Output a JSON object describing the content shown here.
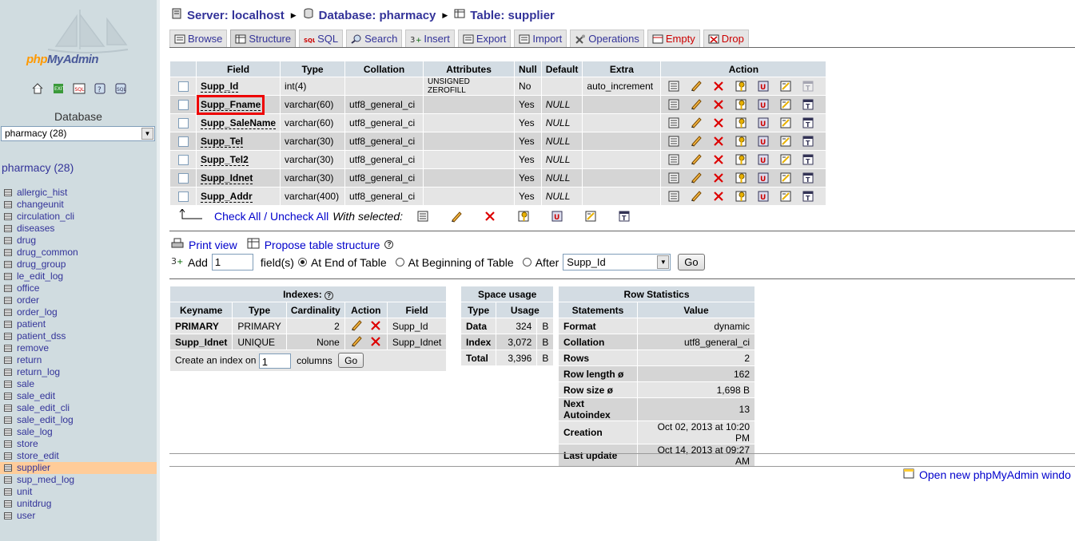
{
  "sidebar": {
    "logo_text_a": "php",
    "logo_text_b": "MyAdmin",
    "quick_icons": [
      "home-icon",
      "exit-icon",
      "sql-icon",
      "docs-icon",
      "query-icon"
    ],
    "database_label": "Database",
    "database_select": "pharmacy (28)",
    "db_heading": "pharmacy (28)",
    "tables": [
      "allergic_hist",
      "changeunit",
      "circulation_cli",
      "diseases",
      "drug",
      "drug_common",
      "drug_group",
      "le_edit_log",
      "office",
      "order",
      "order_log",
      "patient",
      "patient_dss",
      "remove",
      "return",
      "return_log",
      "sale",
      "sale_edit",
      "sale_edit_cli",
      "sale_edit_log",
      "sale_log",
      "store",
      "store_edit",
      "supplier",
      "sup_med_log",
      "unit",
      "unitdrug",
      "user"
    ],
    "selected_table": "supplier"
  },
  "breadcrumb": {
    "server": "Server: localhost",
    "database": "Database: pharmacy",
    "table": "Table: supplier"
  },
  "tabs": [
    {
      "label": "Browse",
      "icon": "browse-icon"
    },
    {
      "label": "Structure",
      "icon": "structure-icon",
      "active": true
    },
    {
      "label": "SQL",
      "icon": "sql-icon"
    },
    {
      "label": "Search",
      "icon": "search-icon"
    },
    {
      "label": "Insert",
      "icon": "insert-icon"
    },
    {
      "label": "Export",
      "icon": "export-icon"
    },
    {
      "label": "Import",
      "icon": "import-icon"
    },
    {
      "label": "Operations",
      "icon": "operations-icon"
    },
    {
      "label": "Empty",
      "icon": "empty-icon",
      "danger": true
    },
    {
      "label": "Drop",
      "icon": "drop-icon",
      "danger": true
    }
  ],
  "fields_table": {
    "headers": [
      "Field",
      "Type",
      "Collation",
      "Attributes",
      "Null",
      "Default",
      "Extra",
      "Action"
    ],
    "rows": [
      {
        "field": "Supp_Id",
        "type": "int(4)",
        "collation": "",
        "attributes": "UNSIGNED ZEROFILL",
        "null": "No",
        "default": "",
        "extra": "auto_increment"
      },
      {
        "field": "Supp_Fname",
        "type": "varchar(60)",
        "collation": "utf8_general_ci",
        "attributes": "",
        "null": "Yes",
        "default": "NULL",
        "extra": "",
        "highlighted": true
      },
      {
        "field": "Supp_SaleName",
        "type": "varchar(60)",
        "collation": "utf8_general_ci",
        "attributes": "",
        "null": "Yes",
        "default": "NULL",
        "extra": ""
      },
      {
        "field": "Supp_Tel",
        "type": "varchar(30)",
        "collation": "utf8_general_ci",
        "attributes": "",
        "null": "Yes",
        "default": "NULL",
        "extra": ""
      },
      {
        "field": "Supp_Tel2",
        "type": "varchar(30)",
        "collation": "utf8_general_ci",
        "attributes": "",
        "null": "Yes",
        "default": "NULL",
        "extra": ""
      },
      {
        "field": "Supp_Idnet",
        "type": "varchar(30)",
        "collation": "utf8_general_ci",
        "attributes": "",
        "null": "Yes",
        "default": "NULL",
        "extra": ""
      },
      {
        "field": "Supp_Addr",
        "type": "varchar(400)",
        "collation": "utf8_general_ci",
        "attributes": "",
        "null": "Yes",
        "default": "NULL",
        "extra": ""
      }
    ],
    "action_icons": [
      "browse-distinct-icon",
      "edit-icon",
      "drop-icon",
      "primary-key-icon",
      "unique-icon",
      "index-icon",
      "fulltext-icon"
    ]
  },
  "with_selected": {
    "check_all": "Check All",
    "slash": " / ",
    "uncheck_all": "Uncheck All",
    "label": "With selected:"
  },
  "print_view": "Print view",
  "propose_structure": "Propose table structure",
  "add_fields": {
    "add_label": "Add",
    "count": "1",
    "fields_label": "field(s)",
    "end_label": "At End of Table",
    "beginning_label": "At Beginning of Table",
    "after_label": "After",
    "after_select": "Supp_Id",
    "go": "Go"
  },
  "indexes": {
    "title": "Indexes:",
    "headers": [
      "Keyname",
      "Type",
      "Cardinality",
      "Action",
      "Field"
    ],
    "rows": [
      {
        "keyname": "PRIMARY",
        "type": "PRIMARY",
        "cardinality": "2",
        "field": "Supp_Id"
      },
      {
        "keyname": "Supp_Idnet",
        "type": "UNIQUE",
        "cardinality": "None",
        "field": "Supp_Idnet"
      }
    ],
    "create_label": "Create an index on",
    "create_count": "1",
    "columns_label": "columns",
    "go": "Go"
  },
  "space_usage": {
    "title": "Space usage",
    "headers": [
      "Type",
      "Usage"
    ],
    "rows": [
      {
        "type": "Data",
        "value": "324",
        "unit": "B"
      },
      {
        "type": "Index",
        "value": "3,072",
        "unit": "B"
      },
      {
        "type": "Total",
        "value": "3,396",
        "unit": "B"
      }
    ]
  },
  "row_stats": {
    "title": "Row Statistics",
    "headers": [
      "Statements",
      "Value"
    ],
    "rows": [
      {
        "label": "Format",
        "value": "dynamic"
      },
      {
        "label": "Collation",
        "value": "utf8_general_ci"
      },
      {
        "label": "Rows",
        "value": "2"
      },
      {
        "label": "Row length ø",
        "value": "162"
      },
      {
        "label": "Row size ø",
        "value": "1,698 B"
      },
      {
        "label": "Next Autoindex",
        "value": "13"
      },
      {
        "label": "Creation",
        "value": "Oct 02, 2013 at 10:20 PM"
      },
      {
        "label": "Last update",
        "value": "Oct 14, 2013 at 09:27 AM"
      }
    ]
  },
  "open_new_window": "Open new phpMyAdmin windo"
}
